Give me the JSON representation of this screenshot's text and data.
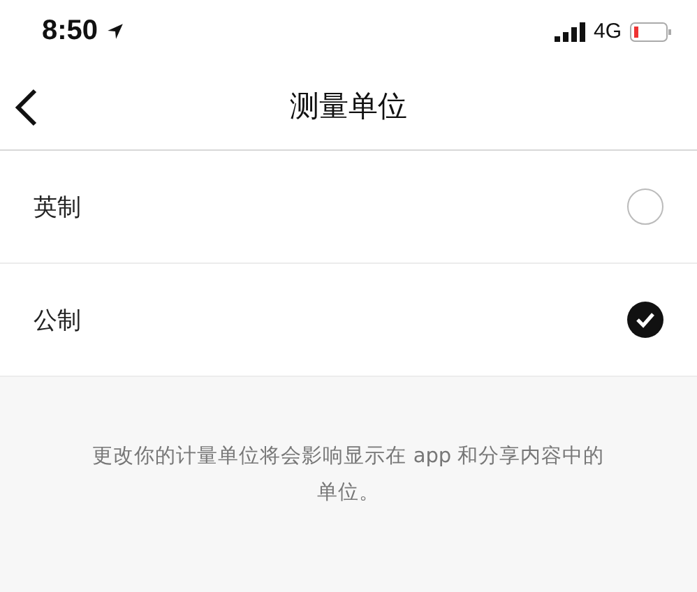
{
  "status_bar": {
    "time": "8:50",
    "network": "4G"
  },
  "nav": {
    "title": "测量单位"
  },
  "options": [
    {
      "label": "英制",
      "selected": false
    },
    {
      "label": "公制",
      "selected": true
    }
  ],
  "footnote": "更改你的计量单位将会影响显示在 app 和分享内容中的单位。"
}
